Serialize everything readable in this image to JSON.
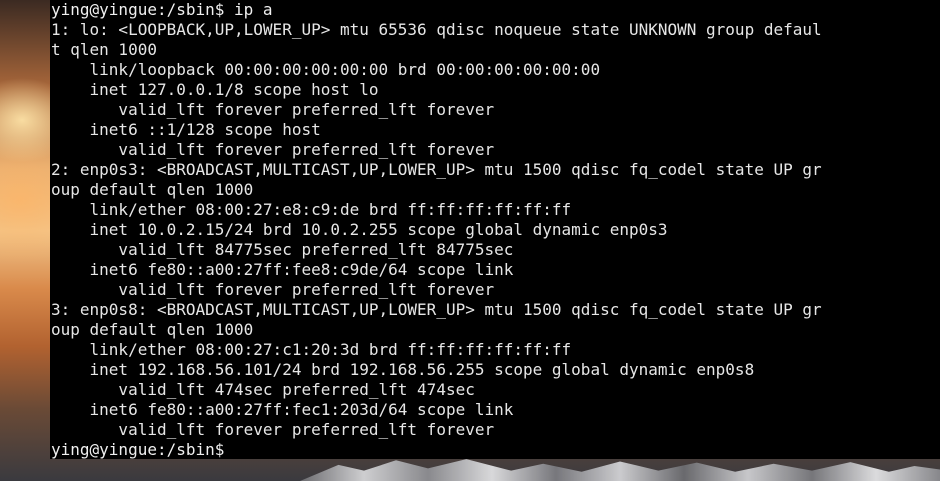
{
  "colors": {
    "terminal_background": "#000000",
    "terminal_text": "#e6e6e6",
    "desktop_sunset": "#e7b074",
    "desktop_dark": "#3a3a3f"
  },
  "terminal": {
    "lines": [
      "ying@yingue:/sbin$ ip a",
      "1: lo: <LOOPBACK,UP,LOWER_UP> mtu 65536 qdisc noqueue state UNKNOWN group defaul",
      "t qlen 1000",
      "    link/loopback 00:00:00:00:00:00 brd 00:00:00:00:00:00",
      "    inet 127.0.0.1/8 scope host lo",
      "       valid_lft forever preferred_lft forever",
      "    inet6 ::1/128 scope host",
      "       valid_lft forever preferred_lft forever",
      "2: enp0s3: <BROADCAST,MULTICAST,UP,LOWER_UP> mtu 1500 qdisc fq_codel state UP gr",
      "oup default qlen 1000",
      "    link/ether 08:00:27:e8:c9:de brd ff:ff:ff:ff:ff:ff",
      "    inet 10.0.2.15/24 brd 10.0.2.255 scope global dynamic enp0s3",
      "       valid_lft 84775sec preferred_lft 84775sec",
      "    inet6 fe80::a00:27ff:fee8:c9de/64 scope link",
      "       valid_lft forever preferred_lft forever",
      "3: enp0s8: <BROADCAST,MULTICAST,UP,LOWER_UP> mtu 1500 qdisc fq_codel state UP gr",
      "oup default qlen 1000",
      "    link/ether 08:00:27:c1:20:3d brd ff:ff:ff:ff:ff:ff",
      "    inet 192.168.56.101/24 brd 192.168.56.255 scope global dynamic enp0s8",
      "       valid_lft 474sec preferred_lft 474sec",
      "    inet6 fe80::a00:27ff:fec1:203d/64 scope link",
      "       valid_lft forever preferred_lft forever",
      "ying@yingue:/sbin$ "
    ]
  }
}
